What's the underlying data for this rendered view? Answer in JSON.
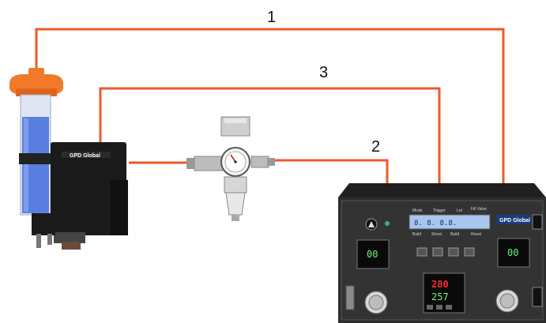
{
  "diagram": {
    "line_labels": [
      "1",
      "3",
      "2"
    ],
    "controller": {
      "brand": "GPD Global",
      "lcd_text": "8.   8.   8.8.",
      "left_gauge": "00",
      "right_gauge": "00",
      "temp_pv": "280",
      "temp_sv": "257"
    },
    "valve": {
      "brand": "GPD Global"
    },
    "colors": {
      "line": "#ee5a2a",
      "cap": "#f07a2a",
      "syringe_fluid": "#5b7fe0",
      "body": "#1a1a1a"
    }
  }
}
